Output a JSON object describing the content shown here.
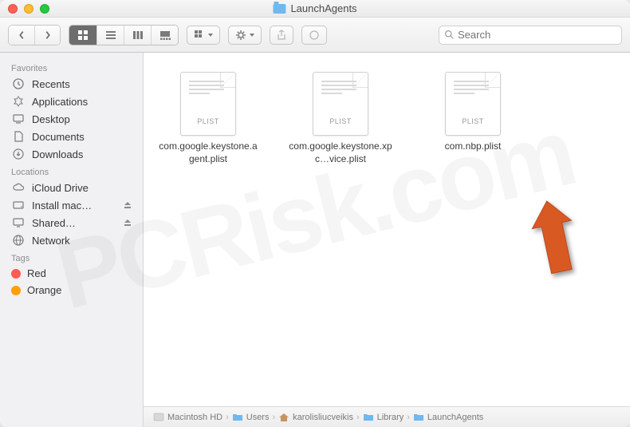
{
  "window": {
    "title": "LaunchAgents"
  },
  "toolbar": {
    "search_placeholder": "Search"
  },
  "sidebar": {
    "sections": [
      {
        "title": "Favorites",
        "items": [
          {
            "label": "Recents",
            "icon": "clock"
          },
          {
            "label": "Applications",
            "icon": "apps"
          },
          {
            "label": "Desktop",
            "icon": "desktop"
          },
          {
            "label": "Documents",
            "icon": "documents"
          },
          {
            "label": "Downloads",
            "icon": "downloads"
          }
        ]
      },
      {
        "title": "Locations",
        "items": [
          {
            "label": "iCloud Drive",
            "icon": "cloud"
          },
          {
            "label": "Install mac…",
            "icon": "disk",
            "eject": true
          },
          {
            "label": "Shared…",
            "icon": "screen",
            "eject": true
          },
          {
            "label": "Network",
            "icon": "globe"
          }
        ]
      },
      {
        "title": "Tags",
        "items": [
          {
            "label": "Red",
            "tag_color": "#ff5b54"
          },
          {
            "label": "Orange",
            "tag_color": "#ff9f0a"
          }
        ]
      }
    ]
  },
  "files": [
    {
      "name": "com.google.keystone.agent.plist",
      "badge": "PLIST"
    },
    {
      "name": "com.google.keystone.xpc…vice.plist",
      "badge": "PLIST"
    },
    {
      "name": "com.nbp.plist",
      "badge": "PLIST"
    }
  ],
  "pathbar": [
    {
      "label": "Macintosh HD",
      "icon": "disk"
    },
    {
      "label": "Users",
      "icon": "folder"
    },
    {
      "label": "karolisliucveikis",
      "icon": "home"
    },
    {
      "label": "Library",
      "icon": "folder"
    },
    {
      "label": "LaunchAgents",
      "icon": "folder"
    }
  ],
  "watermark": "PCRisk.com",
  "annotation_arrow_color": "#d85a22"
}
